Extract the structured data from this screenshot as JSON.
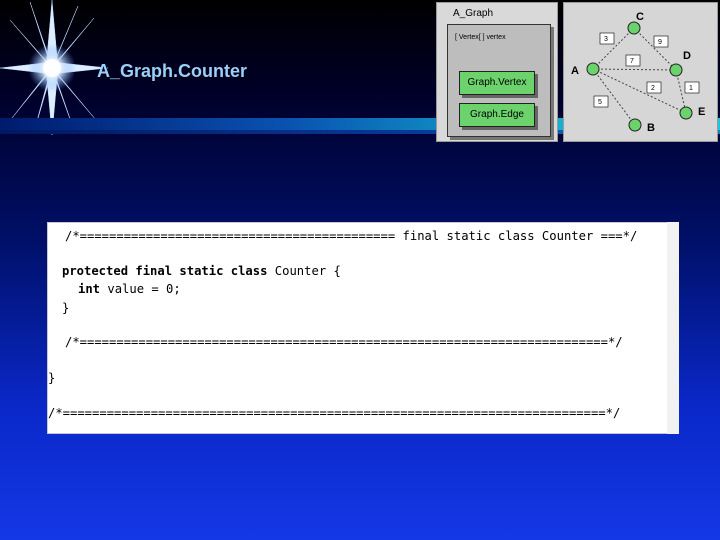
{
  "slide": {
    "title": "A_Graph.Counter"
  },
  "class_diagram": {
    "outer_label": "A_Graph",
    "field_label": "[ Vertex[ ] vertex",
    "inner_classes": [
      "Graph.Vertex",
      "Graph.Edge"
    ]
  },
  "graph_diagram": {
    "nodes": [
      "A",
      "B",
      "C",
      "D",
      "E"
    ],
    "edge_weights": [
      "3",
      "9",
      "7",
      "2",
      "1",
      "5"
    ]
  },
  "code": {
    "line1_comment": "/*=========================================== final static class Counter ===*/",
    "line2_kw": "protected final static class",
    "line2_rest": " Counter {",
    "line3_kw": "int",
    "line3_rest": " value = 0;",
    "line4": "}",
    "line5_comment": "/*========================================================================*/",
    "line6": "}",
    "line7_comment": "/*==========================================================================*/"
  },
  "colors": {
    "title": "#9ad0ff",
    "node": "#6cd36c",
    "accent_bar": "#14b7d0"
  }
}
